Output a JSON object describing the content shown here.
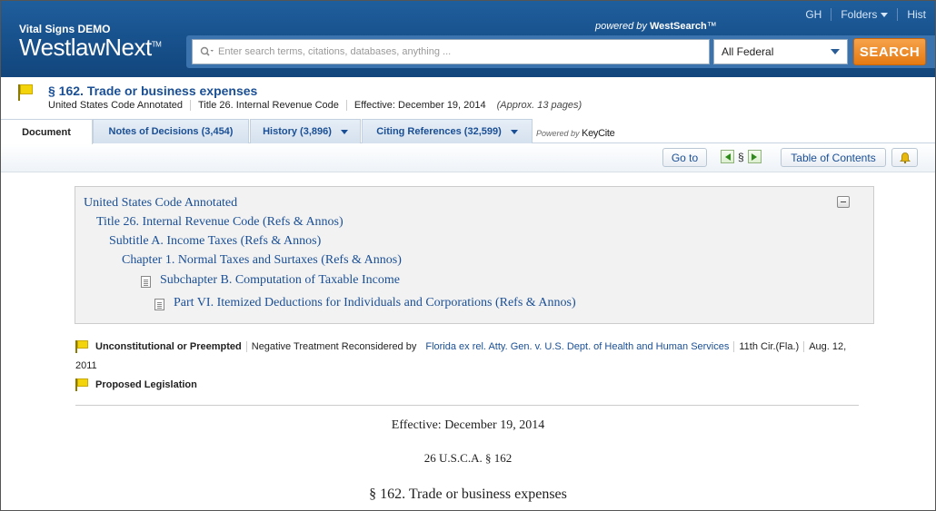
{
  "header": {
    "brand_demo": "Vital Signs DEMO",
    "brand_name": "WestlawNext",
    "brand_tm": "TM",
    "powered_prefix": "powered by",
    "powered_brand": "WestSearch",
    "powered_tm": "™",
    "user_initials": "GH",
    "folders_label": "Folders",
    "history_label": "Hist",
    "search_placeholder": "Enter search terms, citations, databases, anything ...",
    "jurisdiction": "All Federal",
    "search_button": "SEARCH"
  },
  "document": {
    "title": "§ 162. Trade or business expenses",
    "source": "United States Code Annotated",
    "title_ref": "Title 26. Internal Revenue Code",
    "effective": "Effective: December 19, 2014",
    "pages": "(Approx. 13 pages)"
  },
  "tabs": [
    {
      "label": "Document"
    },
    {
      "label": "Notes of Decisions (3,454)"
    },
    {
      "label": "History (3,896)"
    },
    {
      "label": "Citing References (32,599)"
    }
  ],
  "keycite": {
    "prefix": "Powered by",
    "name": "KeyCite"
  },
  "toolbar": {
    "goto": "Go to",
    "section_symbol": "§",
    "toc": "Table of Contents"
  },
  "toc": [
    "United States Code Annotated",
    "Title 26. Internal Revenue Code (Refs & Annos)",
    "Subtitle A. Income Taxes (Refs & Annos)",
    "Chapter 1. Normal Taxes and Surtaxes (Refs & Annos)",
    "Subchapter B. Computation of Taxable Income",
    "Part VI. Itemized Deductions for Individuals and Corporations (Refs & Annos)"
  ],
  "treatment": {
    "status": "Unconstitutional or Preempted",
    "note": "Negative Treatment Reconsidered by",
    "case": "Florida ex rel. Atty. Gen. v. U.S. Dept. of Health and Human Services",
    "court": "11th Cir.(Fla.)",
    "date_part1": "Aug. 12,",
    "date_part2": "2011"
  },
  "proposed": "Proposed Legislation",
  "body": {
    "effective": "Effective: December 19, 2014",
    "citation": "26 U.S.C.A. § 162",
    "heading": "§ 162. Trade or business expenses"
  },
  "colors": {
    "header_blue": "#17508b",
    "link_blue": "#1a4f95",
    "search_orange": "#e57a12",
    "flag_yellow": "#f3d40b"
  }
}
